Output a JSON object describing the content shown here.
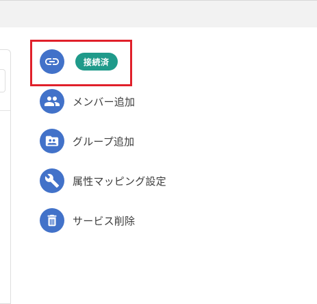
{
  "connection": {
    "icon": "link-icon",
    "status_badge": "接続済"
  },
  "actions": [
    {
      "icon": "people-icon",
      "label": "メンバー追加"
    },
    {
      "icon": "group-folder-icon",
      "label": "グループ追加"
    },
    {
      "icon": "wrench-icon",
      "label": "属性マッピング設定"
    },
    {
      "icon": "trash-icon",
      "label": "サービス削除"
    }
  ],
  "colors": {
    "icon_bg": "#4272c9",
    "badge_bg": "#1f9a8a",
    "highlight": "#e0202a"
  }
}
